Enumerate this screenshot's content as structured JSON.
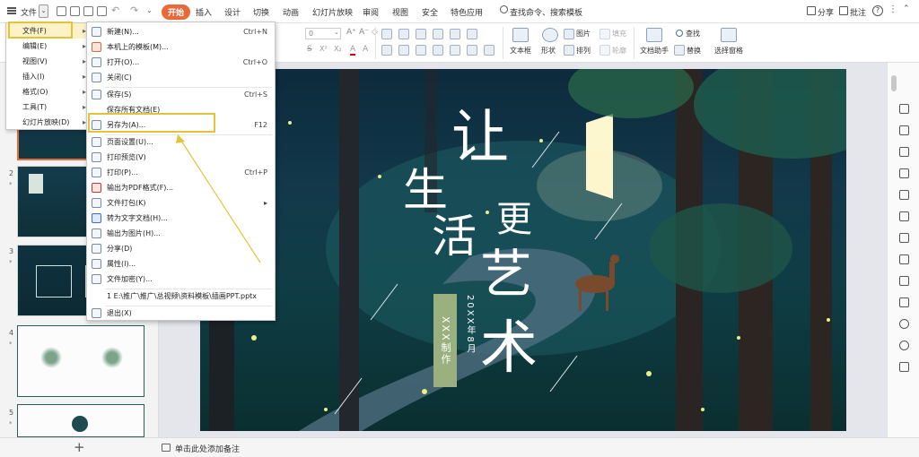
{
  "menubar": {
    "file_label": "文件",
    "tabs": [
      "开始",
      "插入",
      "设计",
      "切换",
      "动画",
      "幻灯片放映",
      "审阅",
      "视图",
      "安全",
      "特色应用"
    ],
    "search_placeholder": "查找命令、搜索模板",
    "share_label": "分享",
    "comment_label": "批注"
  },
  "ribbon": {
    "font_size_value": "0",
    "textbox_label": "文本框",
    "shape_label": "形状",
    "arrange_label": "排列",
    "picture_label": "图片",
    "fill_label": "填充",
    "outline_label": "轮廓",
    "doc_assistant_label": "文档助手",
    "find_label": "查找",
    "replace_label": "替换",
    "select_pane_label": "选择窗格"
  },
  "left_menu": {
    "items": [
      {
        "label": "文件(F)"
      },
      {
        "label": "编辑(E)"
      },
      {
        "label": "视图(V)"
      },
      {
        "label": "插入(I)"
      },
      {
        "label": "格式(O)"
      },
      {
        "label": "工具(T)"
      },
      {
        "label": "幻灯片放映(D)"
      }
    ]
  },
  "file_menu": {
    "items": [
      {
        "label": "新建(N)...",
        "shortcut": "Ctrl+N"
      },
      {
        "label": "本机上的模板(M)...",
        "shortcut": ""
      },
      {
        "label": "打开(O)...",
        "shortcut": "Ctrl+O"
      },
      {
        "label": "关闭(C)",
        "shortcut": ""
      },
      {
        "label": "保存(S)",
        "shortcut": "Ctrl+S"
      },
      {
        "label": "保存所有文档(E)",
        "shortcut": ""
      },
      {
        "label": "另存为(A)...",
        "shortcut": "F12"
      },
      {
        "label": "页面设置(U)...",
        "shortcut": ""
      },
      {
        "label": "打印预览(V)",
        "shortcut": ""
      },
      {
        "label": "打印(P)...",
        "shortcut": "Ctrl+P"
      },
      {
        "label": "输出为PDF格式(F)...",
        "shortcut": ""
      },
      {
        "label": "文件打包(K)",
        "shortcut": ""
      },
      {
        "label": "转为文字文档(H)...",
        "shortcut": ""
      },
      {
        "label": "输出为图片(H)...",
        "shortcut": ""
      },
      {
        "label": "分享(D)",
        "shortcut": ""
      },
      {
        "label": "属性(I)...",
        "shortcut": ""
      },
      {
        "label": "文件加密(Y)...",
        "shortcut": ""
      },
      {
        "label": "1 E:\\推广\\推广\\总视频\\资料模板\\插画PPT.pptx",
        "shortcut": ""
      },
      {
        "label": "退出(X)",
        "shortcut": ""
      }
    ]
  },
  "slide": {
    "title_chars": [
      "让",
      "生",
      "活",
      "更",
      "艺",
      "术"
    ],
    "date_text": "20XX年8月",
    "author_badge": "XXX制作"
  },
  "thumbnails": {
    "numbers": [
      "2",
      "3",
      "4",
      "5"
    ],
    "star": "*"
  },
  "status": {
    "notes_placeholder": "单击此处添加备注",
    "add_slide": "+"
  },
  "colors": {
    "accent": "#e86a3a",
    "highlight": "#e2c537",
    "badge_bg": "#9bb07f"
  }
}
